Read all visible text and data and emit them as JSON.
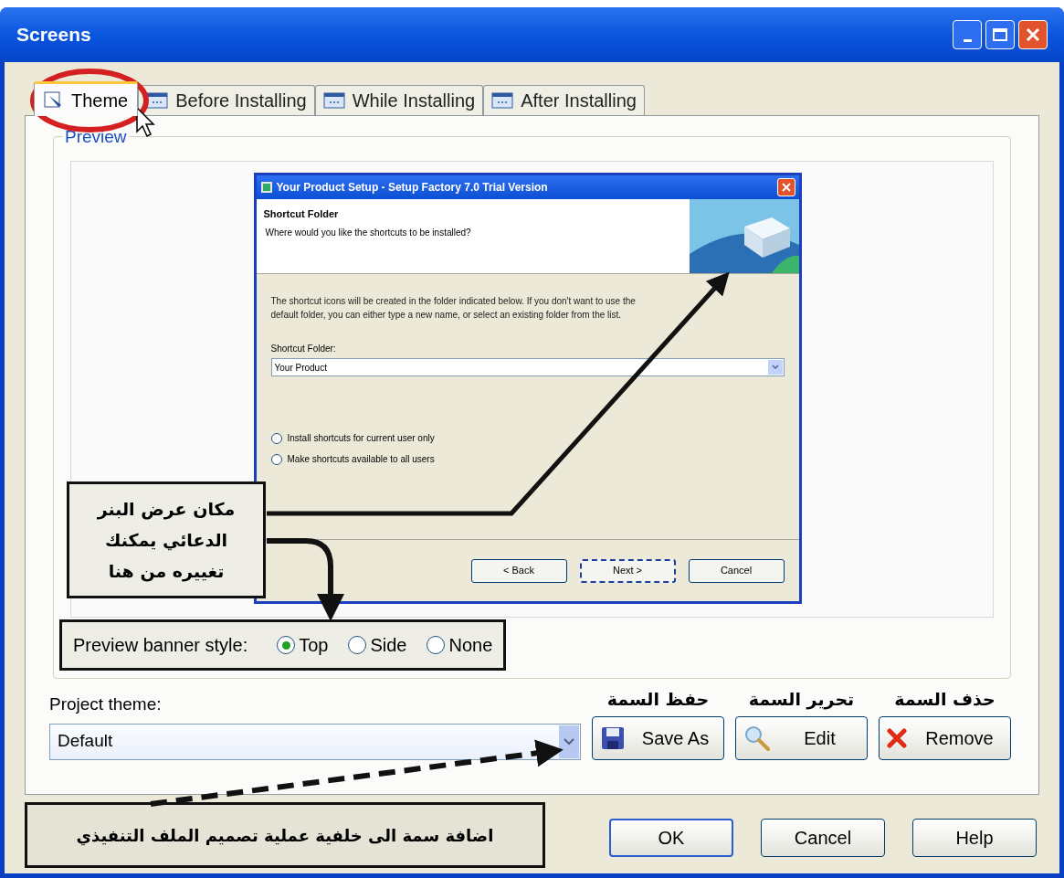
{
  "window": {
    "title": "Screens"
  },
  "tabs": [
    {
      "label": "Theme",
      "kind": "theme",
      "selected": true
    },
    {
      "label": "Before Installing",
      "kind": "screen",
      "selected": false
    },
    {
      "label": "While Installing",
      "kind": "screen",
      "selected": false
    },
    {
      "label": "After Installing",
      "kind": "screen",
      "selected": false
    }
  ],
  "preview": {
    "group_label": "Preview",
    "setup_dialog": {
      "title": "Your Product Setup - Setup Factory 7.0 Trial Version",
      "header_title": "Shortcut Folder",
      "header_subtitle": "Where would you like the shortcuts to be installed?",
      "description": "The shortcut icons will be created in the folder indicated below. If you don't want to use the default folder, you can either type a new name, or select an existing folder from the list.",
      "field_label": "Shortcut Folder:",
      "field_value": "Your Product",
      "options": [
        {
          "label": "Install shortcuts for current user only",
          "selected": false
        },
        {
          "label": "Make shortcuts available to all users",
          "selected": false
        }
      ],
      "buttons": [
        {
          "label": "< Back",
          "focused": false
        },
        {
          "label": "Next >",
          "focused": true
        },
        {
          "label": "Cancel",
          "focused": false
        }
      ]
    },
    "banner_style": {
      "label": "Preview banner style:",
      "options": [
        {
          "label": "Top",
          "selected": true
        },
        {
          "label": "Side",
          "selected": false
        },
        {
          "label": "None",
          "selected": false
        }
      ]
    }
  },
  "button_notes": {
    "save": "حفظ السمة",
    "edit": "تحرير السمة",
    "remove": "حذف السمة"
  },
  "project_theme": {
    "label": "Project theme:",
    "value": "Default",
    "buttons": [
      {
        "label": "Save As",
        "kind": "save"
      },
      {
        "label": "Edit",
        "kind": "edit"
      },
      {
        "label": "Remove",
        "kind": "remove"
      }
    ]
  },
  "dialog_buttons": [
    "OK",
    "Cancel",
    "Help"
  ],
  "annotations": {
    "banner_callout": "مكان عرض البنر الدعائي يمكنك تغييره من هنا",
    "theme_callout": "اضافة سمة الى خلفية عملية تصميم الملف التنفيذي"
  }
}
